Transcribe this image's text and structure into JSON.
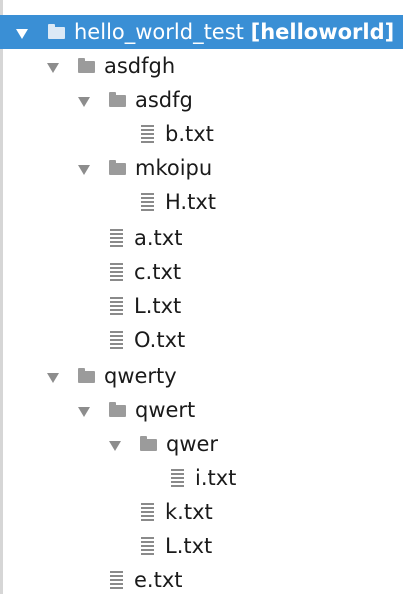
{
  "tree": {
    "root": {
      "name": "hello_world_test",
      "module": "[helloworld]",
      "icon": "folder-icon",
      "expanded": true,
      "selected": true
    },
    "folders": [
      {
        "name": "asdfgh",
        "icon": "folder-icon",
        "expanded": true
      },
      {
        "name": "asdfg",
        "icon": "folder-icon",
        "expanded": true
      },
      {
        "name": "mkoipu",
        "icon": "folder-icon",
        "expanded": true
      },
      {
        "name": "qwerty",
        "icon": "folder-icon",
        "expanded": true
      },
      {
        "name": "qwert",
        "icon": "folder-icon",
        "expanded": true
      },
      {
        "name": "qwer",
        "icon": "folder-icon",
        "expanded": true
      }
    ],
    "files": [
      {
        "name": "b.txt",
        "icon": "text-file-icon"
      },
      {
        "name": "H.txt",
        "icon": "text-file-icon"
      },
      {
        "name": "a.txt",
        "icon": "text-file-icon"
      },
      {
        "name": "c.txt",
        "icon": "text-file-icon"
      },
      {
        "name": "L.txt",
        "icon": "text-file-icon"
      },
      {
        "name": "O.txt",
        "icon": "text-file-icon"
      },
      {
        "name": "i.txt",
        "icon": "text-file-icon"
      },
      {
        "name": "k.txt",
        "icon": "text-file-icon"
      },
      {
        "name": "L.txt",
        "icon": "text-file-icon"
      },
      {
        "name": "e.txt",
        "icon": "text-file-icon"
      }
    ]
  },
  "colors": {
    "selection": "#3a8fd5",
    "text": "#1a1a1a",
    "icon": "#9b9b9b"
  }
}
